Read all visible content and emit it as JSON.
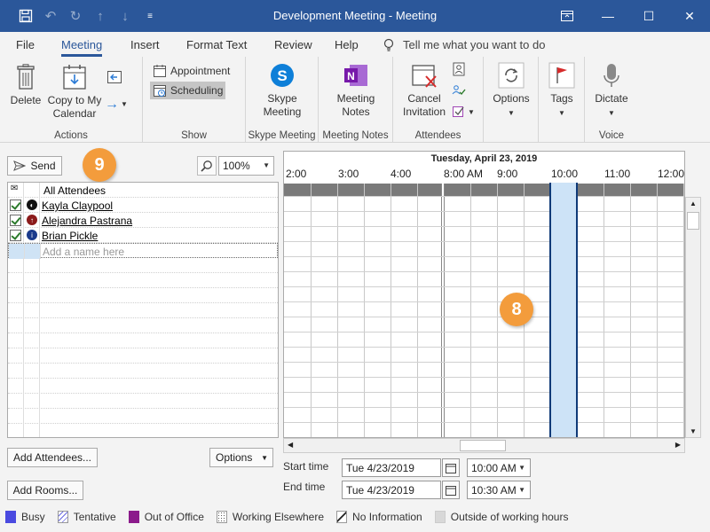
{
  "window": {
    "title": "Development Meeting - Meeting"
  },
  "ribbon_tabs": [
    "File",
    "Meeting",
    "Insert",
    "Format Text",
    "Review",
    "Help"
  ],
  "tell_me": "Tell me what you want to do",
  "ribbon": {
    "actions": {
      "delete": "Delete",
      "copy_line1": "Copy to My",
      "copy_line2": "Calendar",
      "label": "Actions"
    },
    "show": {
      "appointment": "Appointment",
      "scheduling": "Scheduling",
      "label": "Show"
    },
    "skype": {
      "line1": "Skype",
      "line2": "Meeting",
      "label": "Skype Meeting"
    },
    "notes": {
      "line1": "Meeting",
      "line2": "Notes",
      "label": "Meeting Notes"
    },
    "attendees": {
      "line1": "Cancel",
      "line2": "Invitation",
      "label": "Attendees"
    },
    "options": {
      "label_btn": "Options"
    },
    "tags": {
      "label_btn": "Tags"
    },
    "voice": {
      "label_btn": "Dictate",
      "label": "Voice"
    }
  },
  "left": {
    "send": "Send",
    "zoom": "100%",
    "header": "All Attendees",
    "attendees": [
      "Kayla Claypool",
      "Alejandra Pastrana",
      "Brian Pickle"
    ],
    "add_placeholder": "Add a name here",
    "add_attendees": "Add Attendees...",
    "add_rooms": "Add Rooms...",
    "options": "Options"
  },
  "schedule": {
    "date": "Tuesday, April 23, 2019",
    "hours": [
      "2:00",
      "3:00",
      "4:00",
      "8:00 AM",
      "9:00",
      "10:00",
      "11:00",
      "12:00"
    ]
  },
  "time": {
    "start_label": "Start time",
    "end_label": "End time",
    "start_date": "Tue 4/23/2019",
    "start_time": "10:00 AM",
    "end_date": "Tue 4/23/2019",
    "end_time": "10:30 AM"
  },
  "legend": [
    "Busy",
    "Tentative",
    "Out of Office",
    "Working Elsewhere",
    "No Information",
    "Outside of working hours"
  ],
  "badges": {
    "send": "9",
    "slot": "8"
  },
  "colors": {
    "accent": "#2b579a",
    "busy": "#4a4ae0",
    "ooo": "#8b1a8b",
    "meeting": "#cde3f7",
    "badge": "#f39c3c"
  }
}
